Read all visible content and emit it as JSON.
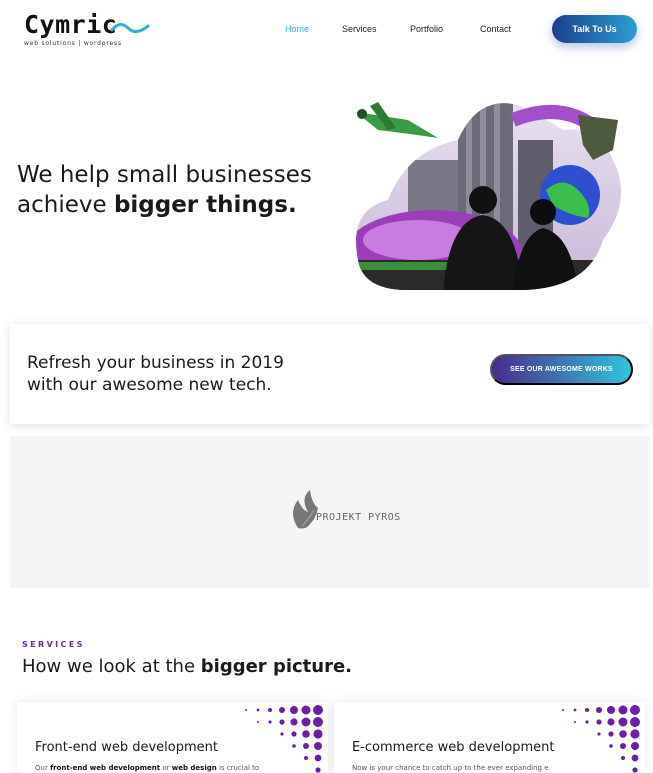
{
  "brand": {
    "name": "Cymric",
    "tagline": "web solutions | wordpress"
  },
  "nav": {
    "items": [
      {
        "label": "Home",
        "active": true
      },
      {
        "label": "Services",
        "active": false
      },
      {
        "label": "Portfolio",
        "active": false
      },
      {
        "label": "Contact",
        "active": false
      }
    ],
    "cta_label": "Talk To Us"
  },
  "hero": {
    "line1": "We help small businesses",
    "line2_prefix": "achieve",
    "line2_bold": "bigger things."
  },
  "refresh": {
    "line1": "Refresh your business in 2019",
    "line2": "with our awesome new tech.",
    "button_label": "SEE OUR AWESOME WORKS"
  },
  "clients": {
    "logo_name": "PROJEKT PYROS"
  },
  "services": {
    "kicker": "SERVICES",
    "heading_prefix": "How we look at the",
    "heading_bold": "bigger picture.",
    "cards": [
      {
        "title": "Front-end web development",
        "desc_1": "Our ",
        "desc_2": "front-end web development",
        "desc_3": " or ",
        "desc_4": "web design",
        "desc_5": " is crucial to"
      },
      {
        "title": "E-commerce web development",
        "desc_1": "Now is your chance to catch up to the ever expanding e"
      }
    ]
  },
  "colors": {
    "accent_cyan": "#2ab1d4",
    "accent_purple": "#6a2b9e",
    "button_blue": "#1b3f8c"
  }
}
